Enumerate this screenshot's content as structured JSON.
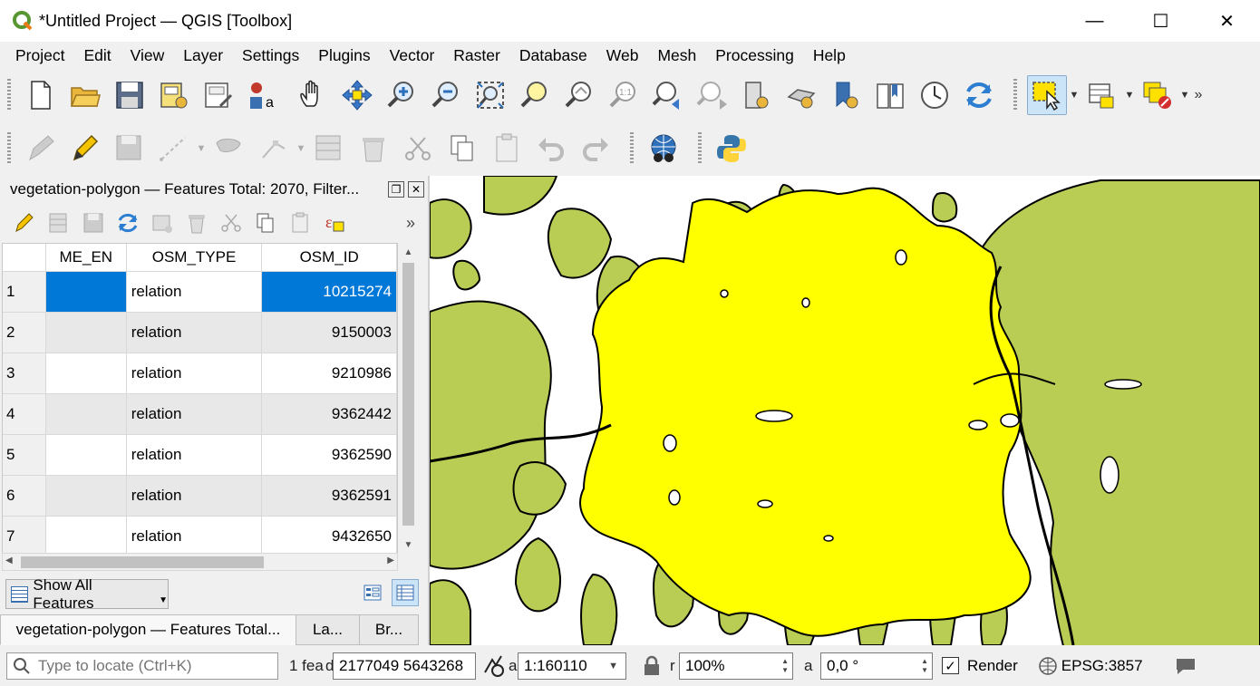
{
  "window": {
    "title": "*Untitled Project — QGIS [Toolbox]",
    "controls": {
      "minimize": "—",
      "maximize": "☐",
      "close": "✕"
    }
  },
  "menubar": [
    "Project",
    "Edit",
    "View",
    "Layer",
    "Settings",
    "Plugins",
    "Vector",
    "Raster",
    "Database",
    "Web",
    "Mesh",
    "Processing",
    "Help"
  ],
  "toolbar_main_icons": [
    "new-project-icon",
    "open-project-icon",
    "save-project-icon",
    "new-print-layout-icon",
    "layout-manager-icon",
    "style-manager-icon",
    "pan-map-icon",
    "pan-to-selection-icon",
    "zoom-in-icon",
    "zoom-out-icon",
    "zoom-full-icon",
    "zoom-to-selection-icon",
    "zoom-to-layer-icon",
    "zoom-native-icon",
    "zoom-last-icon",
    "zoom-next-icon",
    "new-map-view-icon",
    "new-3d-view-icon",
    "new-bookmark-icon",
    "show-bookmarks-icon",
    "temporal-controller-icon",
    "refresh-icon",
    "select-features-icon",
    "open-attribute-table-icon",
    "deselect-all-icon"
  ],
  "toolbar_digitize_icons": [
    "current-edits-icon",
    "toggle-editing-icon",
    "save-layer-edits-icon",
    "add-feature-icon",
    "add-polygon-icon",
    "vertex-tool-icon",
    "modify-attributes-icon",
    "delete-selected-icon",
    "cut-features-icon",
    "copy-features-icon",
    "paste-features-icon",
    "undo-icon",
    "redo-icon",
    "globe-plugin-icon",
    "python-console-icon"
  ],
  "attribute_panel": {
    "title": "vegetation-polygon — Features Total: 2070, Filter...",
    "toolbar_icons": [
      "toggle-edit-icon",
      "multi-edit-icon",
      "save-edits-icon",
      "reload-icon",
      "add-feature-icon",
      "delete-feature-icon",
      "cut-icon",
      "copy-icon",
      "paste-icon",
      "expression-select-icon"
    ],
    "more": "»",
    "columns": [
      "ME_EN",
      "OSM_TYPE",
      "OSM_ID"
    ],
    "rows": [
      {
        "n": "1",
        "me_en": "",
        "osm_type": "relation",
        "osm_id": "10215274"
      },
      {
        "n": "2",
        "me_en": "",
        "osm_type": "relation",
        "osm_id": "9150003"
      },
      {
        "n": "3",
        "me_en": "",
        "osm_type": "relation",
        "osm_id": "9210986"
      },
      {
        "n": "4",
        "me_en": "",
        "osm_type": "relation",
        "osm_id": "9362442"
      },
      {
        "n": "5",
        "me_en": "",
        "osm_type": "relation",
        "osm_id": "9362590"
      },
      {
        "n": "6",
        "me_en": "",
        "osm_type": "relation",
        "osm_id": "9362591"
      },
      {
        "n": "7",
        "me_en": "",
        "osm_type": "relation",
        "osm_id": "9432650"
      }
    ],
    "show_all_label": "Show All Features",
    "tabs": [
      "vegetation-polygon — Features Total...",
      "La...",
      "Br..."
    ]
  },
  "statusbar": {
    "locate_placeholder": "Type to locate (Ctrl+K)",
    "features_label": "1 fea",
    "coord_prefix": "d",
    "coordinate": "2177049  5643268",
    "scale_prefix": "a",
    "scale": "1:160110",
    "magnifier_prefix": "r",
    "magnifier": "100%",
    "rotation_prefix": "a",
    "rotation": "0,0 °",
    "render_label": "Render",
    "render_checked": true,
    "crs": "EPSG:3857"
  },
  "colors": {
    "vegetation_fill": "#b9cc54",
    "selected_fill": "#ffff00",
    "outline": "#000000",
    "selection_blue": "#0078d7"
  }
}
